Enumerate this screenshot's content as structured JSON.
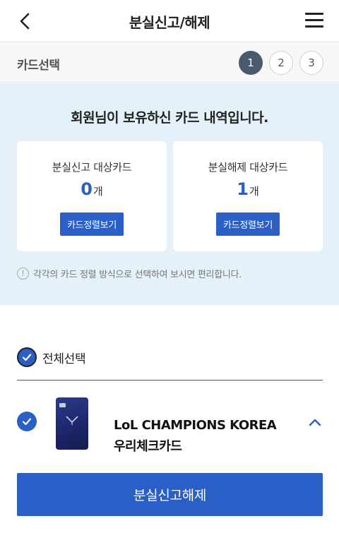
{
  "header": {
    "title": "분실신고/해제",
    "back_icon": "chevron-left-icon",
    "menu_icon": "hamburger-menu-icon"
  },
  "stepbar": {
    "label": "카드선택",
    "steps": [
      "1",
      "2",
      "3"
    ],
    "active_step": 1
  },
  "summary": {
    "title": "회원님이 보유하신 카드 내역입니다.",
    "lost_report": {
      "label": "분실신고 대상카드",
      "count": "0",
      "unit": "개",
      "button": "카드정렬보기"
    },
    "lost_release": {
      "label": "분실해제 대상카드",
      "count": "1",
      "unit": "개",
      "button": "카드정렬보기"
    },
    "info_text": "각각의 카드 정렬 방식으로 선택하여 보시면 편리합니다."
  },
  "select_all": {
    "label": "전체선택",
    "checked": true
  },
  "cards": [
    {
      "name": "LoL CHAMPIONS KOREA 우리체크카드",
      "checked": true,
      "expanded": true
    }
  ],
  "submit": {
    "label": "분실신고해제"
  },
  "colors": {
    "primary": "#2a5fc7",
    "summary_bg": "#e4f1f9",
    "step_active": "#4a5a6e"
  }
}
